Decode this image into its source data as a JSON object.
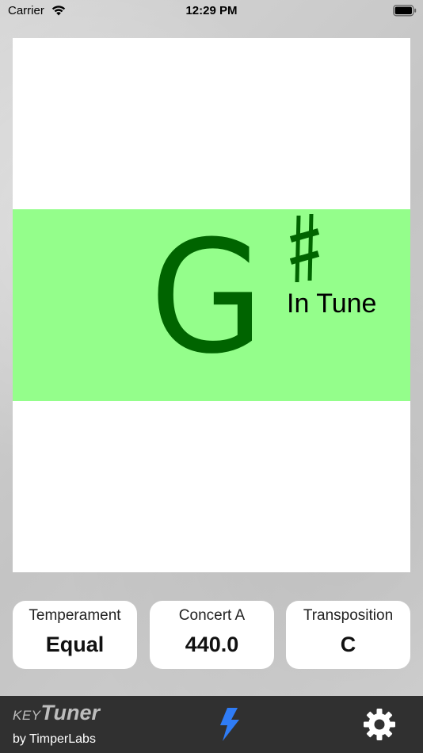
{
  "status_bar": {
    "carrier": "Carrier",
    "time": "12:29 PM"
  },
  "tuner": {
    "note": "G",
    "accidental_icon": "sharp-icon",
    "status": "In Tune",
    "band_color": "#94fe8b",
    "note_color": "#006400"
  },
  "settings": {
    "temperament": {
      "label": "Temperament",
      "value": "Equal"
    },
    "concert_a": {
      "label": "Concert A",
      "value": "440.0"
    },
    "transposition": {
      "label": "Transposition",
      "value": "C"
    }
  },
  "bottom_bar": {
    "brand_key": "KEY",
    "brand_tuner": "Tuner",
    "brand_by": "by TimperLabs",
    "bolt_icon": "lightning-bolt-icon",
    "bolt_color": "#2f7cf6",
    "settings_icon": "gear-icon"
  }
}
